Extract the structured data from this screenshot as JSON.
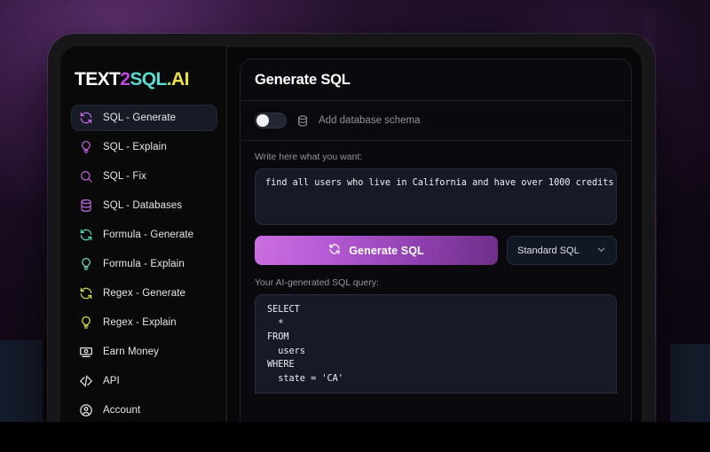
{
  "brand": {
    "logo_parts": [
      {
        "text": "TEXT",
        "color": "#ffffff"
      },
      {
        "text": "2",
        "color": "#c04ae0"
      },
      {
        "text": "SQL",
        "color": "#5bd9d0"
      },
      {
        "text": ".",
        "color": "#a8e04a"
      },
      {
        "text": "AI",
        "color": "#ece04a"
      }
    ]
  },
  "sidebar": {
    "items": [
      {
        "label": "SQL - Generate",
        "icon": "refresh-icon",
        "color": "#c463e8",
        "active": true
      },
      {
        "label": "SQL - Explain",
        "icon": "bulb-icon",
        "color": "#c463e8",
        "active": false
      },
      {
        "label": "SQL - Fix",
        "icon": "search-icon",
        "color": "#c463e8",
        "active": false
      },
      {
        "label": "SQL - Databases",
        "icon": "database-icon",
        "color": "#c463e8",
        "active": false
      },
      {
        "label": "Formula - Generate",
        "icon": "refresh-icon",
        "color": "#4fd6c0",
        "active": false
      },
      {
        "label": "Formula - Explain",
        "icon": "bulb-icon",
        "color": "#6fd9b9",
        "active": false
      },
      {
        "label": "Regex - Generate",
        "icon": "refresh-icon",
        "color": "#c5e04a",
        "active": false
      },
      {
        "label": "Regex - Explain",
        "icon": "bulb-icon",
        "color": "#dfe04a",
        "active": false
      },
      {
        "label": "Earn Money",
        "icon": "banknote-icon",
        "color": "#e9e9ee",
        "active": false
      },
      {
        "label": "API",
        "icon": "code-icon",
        "color": "#e9e9ee",
        "active": false
      },
      {
        "label": "Account",
        "icon": "user-icon",
        "color": "#e9e9ee",
        "active": false
      }
    ]
  },
  "main": {
    "title": "Generate SQL",
    "schema": {
      "toggle_on": false,
      "label": "Add database schema"
    },
    "prompt": {
      "label": "Write here what you want:",
      "value": "find all users who live in California and have over 1000 credits",
      "placeholder": "Write here what you want:"
    },
    "generate_button": {
      "label": "Generate SQL",
      "icon": "refresh-icon",
      "gradient_from": "#cb6ee0",
      "gradient_to": "#6e2f88"
    },
    "dialect": {
      "selected": "Standard SQL",
      "icon": "chevron-down-icon"
    },
    "output": {
      "label": "Your AI-generated SQL query:",
      "lines": [
        "SELECT",
        "  *",
        "FROM",
        "  users",
        "WHERE",
        "  state = 'CA'"
      ]
    }
  }
}
